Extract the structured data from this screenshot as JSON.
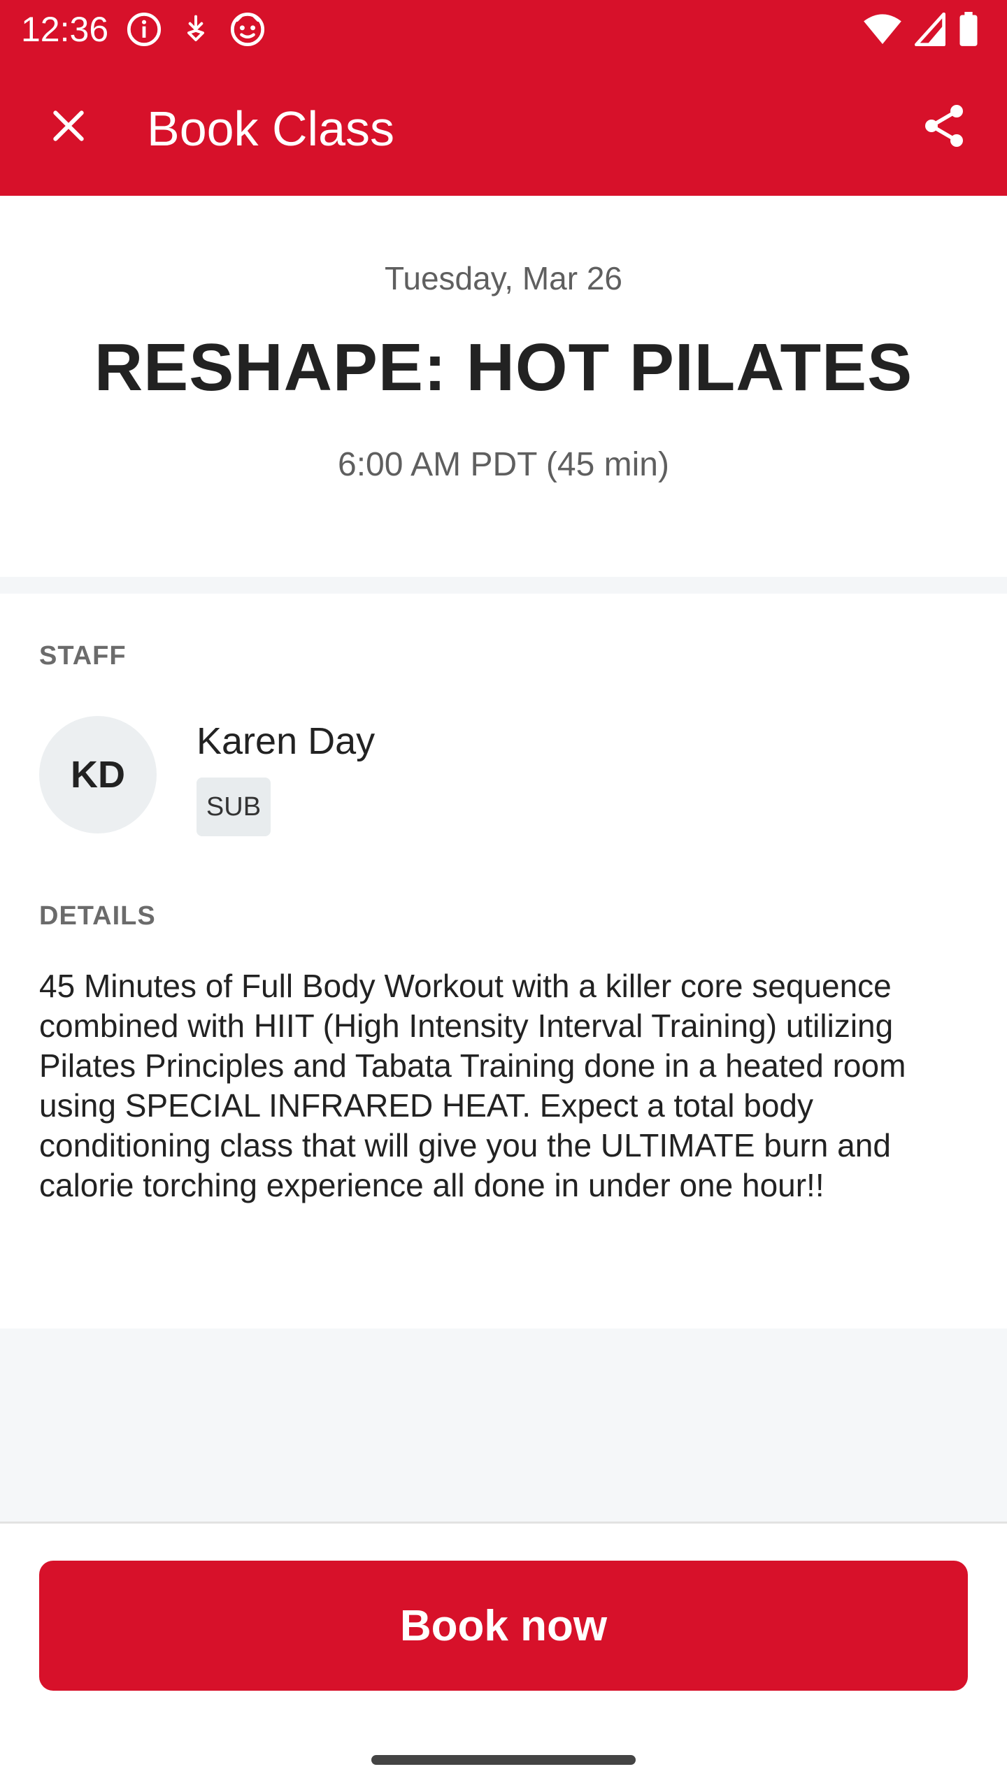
{
  "status_bar": {
    "time": "12:36",
    "icons_left": [
      "info-icon",
      "download-notification-icon",
      "face-notification-icon"
    ],
    "icons_right": [
      "wifi-icon",
      "cell-signal-icon",
      "battery-icon"
    ]
  },
  "app_bar": {
    "title": "Book Class",
    "close_icon": "close-icon",
    "share_icon": "share-icon"
  },
  "class_info": {
    "date": "Tuesday, Mar 26",
    "title": "RESHAPE: HOT PILATES",
    "time": "6:00 AM PDT (45 min)"
  },
  "staff": {
    "label": "STAFF",
    "initials": "KD",
    "name": "Karen Day",
    "badge": "SUB"
  },
  "details": {
    "label": "DETAILS",
    "text": "45 Minutes of Full Body Workout with a killer core sequence combined with HIIT (High Intensity Interval Training) utilizing Pilates Principles and Tabata Training done in a heated room using SPECIAL INFRARED HEAT. Expect a total body conditioning class that will give you the ULTIMATE burn and calorie torching experience all done in under one hour!!"
  },
  "actions": {
    "book_label": "Book now"
  },
  "colors": {
    "brand": "#d7112a",
    "text_primary": "#222222",
    "text_secondary": "#5f5f5f",
    "section_bg": "#f5f7f9"
  }
}
